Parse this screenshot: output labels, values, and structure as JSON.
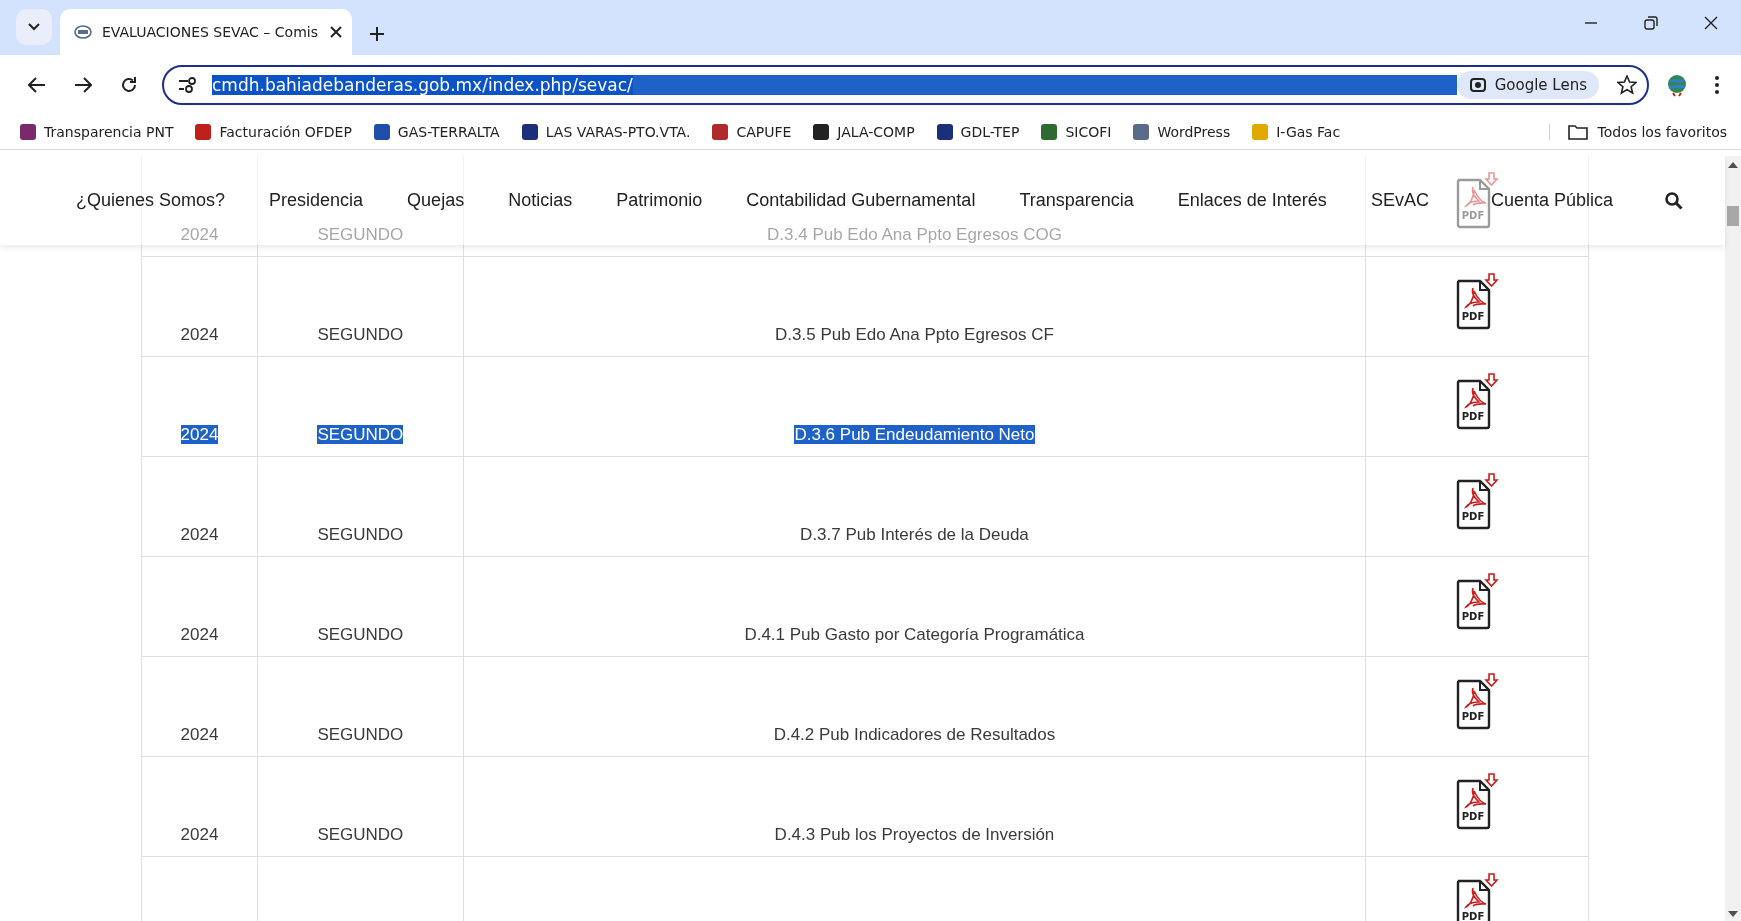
{
  "browser": {
    "tab_title": "EVALUACIONES SEVAC – Comis",
    "url": "cmdh.bahiadebanderas.gob.mx/index.php/sevac/",
    "url_selected": true,
    "lens_label": "Google Lens",
    "bookmarks": [
      {
        "label": "Transparencia PNT",
        "color": "#7a2a6a"
      },
      {
        "label": "Facturación OFDEP",
        "color": "#c0201c"
      },
      {
        "label": "GAS-TERRALTA",
        "color": "#1f4fa8"
      },
      {
        "label": "LAS VARAS-PTO.VTA.",
        "color": "#1c2f7a"
      },
      {
        "label": "CAPUFE",
        "color": "#b02a2a"
      },
      {
        "label": "JALA-COMP",
        "color": "#222222"
      },
      {
        "label": "GDL-TEP",
        "color": "#1c2f7a"
      },
      {
        "label": "SICOFI",
        "color": "#2e6b2e"
      },
      {
        "label": "WordPress",
        "color": "#5a6b8a"
      },
      {
        "label": "I-Gas Fac",
        "color": "#e0a800"
      }
    ],
    "all_bookmarks": "Todos los favoritos"
  },
  "nav": {
    "items": [
      "¿Quienes Somos?",
      "Presidencia",
      "Quejas",
      "Noticias",
      "Patrimonio",
      "Contabilidad Gubernamental",
      "Transparencia",
      "Enlaces de Interés",
      "SEvAC",
      "Cuenta Pública"
    ]
  },
  "table": {
    "rows": [
      {
        "year": "2024",
        "period": "SEGUNDO",
        "document": "D.3.4 Pub Edo Ana Ppto Egresos COG",
        "pdf": "PDF",
        "selected": false
      },
      {
        "year": "2024",
        "period": "SEGUNDO",
        "document": "D.3.5 Pub Edo Ana Ppto Egresos CF",
        "pdf": "PDF",
        "selected": false
      },
      {
        "year": "2024",
        "period": "SEGUNDO",
        "document": "D.3.6 Pub Endeudamiento Neto",
        "pdf": "PDF",
        "selected": true
      },
      {
        "year": "2024",
        "period": "SEGUNDO",
        "document": "D.3.7 Pub Interés de la Deuda",
        "pdf": "PDF",
        "selected": false
      },
      {
        "year": "2024",
        "period": "SEGUNDO",
        "document": "D.4.1 Pub Gasto por Categoría Programática",
        "pdf": "PDF",
        "selected": false
      },
      {
        "year": "2024",
        "period": "SEGUNDO",
        "document": "D.4.2 Pub Indicadores de Resultados",
        "pdf": "PDF",
        "selected": false
      },
      {
        "year": "2024",
        "period": "SEGUNDO",
        "document": "D.4.3 Pub los Proyectos de Inversión",
        "pdf": "PDF",
        "selected": false
      },
      {
        "pdf": "PDF"
      }
    ]
  }
}
